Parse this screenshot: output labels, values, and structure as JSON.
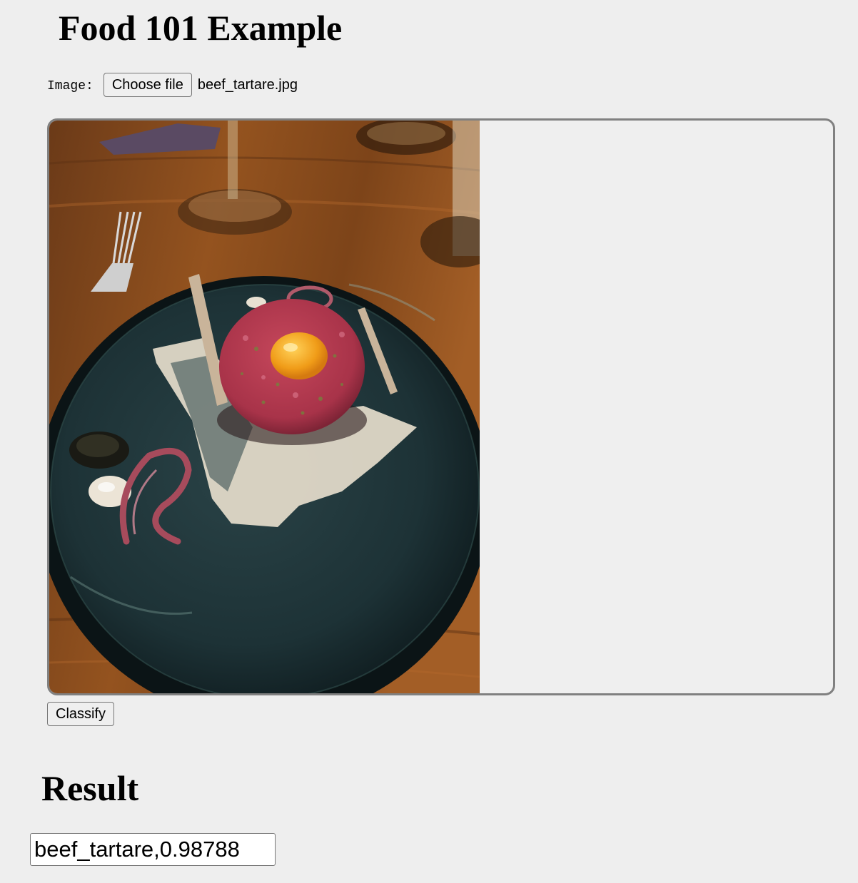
{
  "page": {
    "title": "Food 101 Example"
  },
  "upload": {
    "label": "Image:",
    "button_label": "Choose file",
    "file_name": "beef_tartare.jpg"
  },
  "preview": {
    "icon": "food-photo",
    "subject": "beef tartare with egg yolk on dark plate",
    "colors": {
      "table_wood": "#8a4a1c",
      "plate": "#1f3538",
      "tartare": "#b0394e",
      "yolk": "#f0a21c",
      "sauce": "#e6ddcc"
    }
  },
  "actions": {
    "classify_label": "Classify"
  },
  "result": {
    "heading": "Result",
    "value": "beef_tartare,0.98788"
  }
}
